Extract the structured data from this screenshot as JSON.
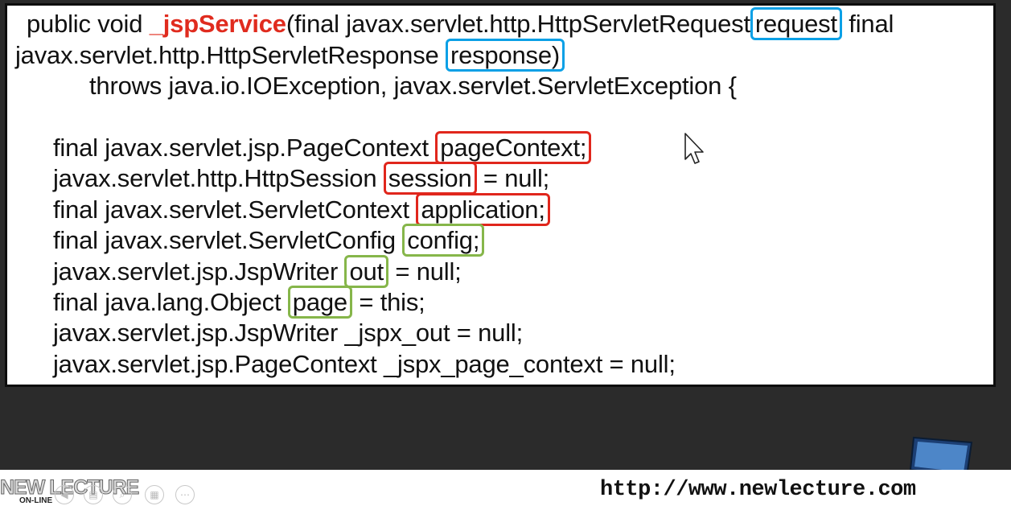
{
  "code": {
    "l1": {
      "a": "public void ",
      "b": "_jspService",
      "c": "(final javax.servlet.http.HttpServletRequest",
      "d": "request",
      "e": " final"
    },
    "l2": {
      "a": "javax.servlet.http.HttpServletResponse ",
      "b": "response)"
    },
    "l3": "throws java.io.IOException, javax.servlet.ServletException {",
    "l4": {
      "a": "final javax.servlet.jsp.PageContext ",
      "b": "pageContext;"
    },
    "l5": {
      "a": "javax.servlet.http.HttpSession ",
      "b": "session",
      "c": " = null;"
    },
    "l6": {
      "a": "final javax.servlet.ServletContext ",
      "b": "application;"
    },
    "l7": {
      "a": "final javax.servlet.ServletConfig ",
      "b": "config;"
    },
    "l8": {
      "a": "javax.servlet.jsp.JspWriter ",
      "b": "out",
      "c": " = null;"
    },
    "l9": {
      "a": "final java.lang.Object ",
      "b": "page",
      "c": " = this;"
    },
    "l10": "javax.servlet.jsp.JspWriter _jspx_out = null;",
    "l11": "javax.servlet.jsp.PageContext _jspx_page_context = null;"
  },
  "footer": {
    "brand": "NEW LECTURE",
    "brand_sub": "ON-LINE",
    "url": "http://www.newlecture.com"
  },
  "icons": {
    "controls": [
      "back-icon",
      "page-icon",
      "zoom-icon",
      "slides-icon",
      "more-icon"
    ],
    "cursor": "mouse-pointer-icon",
    "logo": "computer-monitor-icon"
  },
  "colors": {
    "keyword": "#e02b1e",
    "param_box": "#0aa0e6",
    "implicit_box_red": "#e0261c",
    "implicit_box_green": "#86b64a"
  }
}
